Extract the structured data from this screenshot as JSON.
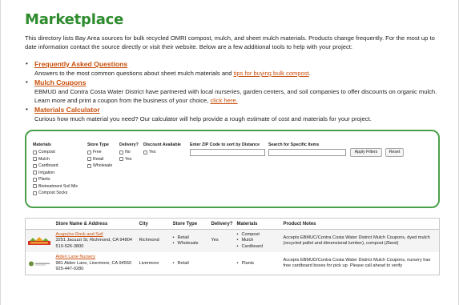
{
  "page": {
    "title": "Marketplace",
    "intro": "This directory lists Bay Area sources for bulk recycled OMRI compost, mulch, and sheet mulch materials. Products change frequently. For the most up to date information contact the source directly or visit their website. Below are a few additional tools to help with your project:"
  },
  "tools": [
    {
      "title": "Frequently Asked Questions",
      "desc": "Answers to the most common questions about sheet mulch materials and ",
      "link": "tips for buying bulk compost",
      "after": "."
    },
    {
      "title": "Mulch Coupons",
      "desc": "EBMUD and Contra Costa Water District have partnered with local nurseries, garden centers, and soil companies to offer discounts on organic mulch. Learn more and print a coupon from the business of your choice, ",
      "link": "click here.",
      "after": ""
    },
    {
      "title": "Materials Calculator",
      "desc": "Curious how much material you need?  Our calculator will help provide a rough estimate of cost and materials for your project.",
      "link": "",
      "after": ""
    }
  ],
  "filters": {
    "materials_label": "Materials",
    "materials": [
      "Compost",
      "Mulch",
      "Cardboard",
      "Irrigation",
      "Plants",
      "Biotreatment Soil Mix",
      "Compost Socks"
    ],
    "store_type_label": "Store Type",
    "store_types": [
      "Free",
      "Retail",
      "Wholesale"
    ],
    "delivery_label": "Delivery?",
    "delivery": [
      "No",
      "Yes"
    ],
    "discount_label": "Discount Available",
    "discount": [
      "Yes"
    ],
    "zip_label": "Enter ZIP Code to sort by Distance",
    "zip_value": "",
    "search_label": "Search for Specific Items",
    "search_value": "",
    "apply_label": "Apply Filters",
    "reset_label": "Reset"
  },
  "table": {
    "headers": [
      "",
      "Store Name & Address",
      "City",
      "Store Type",
      "Delivery?",
      "Materials",
      "Product Notes"
    ],
    "rows": [
      {
        "logo": "acapulco-logo",
        "name": "Acapulco Rock and Soil",
        "address": "3251 Jacuzzi St, Richmond, CA 94804",
        "phone": "510-526-3800",
        "city": "Richmond",
        "store_type": [
          "Retail",
          "Wholesale"
        ],
        "delivery": "Yes",
        "materials": [
          "Compost",
          "Mulch",
          "Cardboard"
        ],
        "notes": "Accepts EBMUC/Contra Costa Water District Mulch Coupons, dyed mulch (recycled pallet and dimensional lumber), compost (Zbest)"
      },
      {
        "logo": "alden-lane-logo",
        "name": "Alden Lane Nursery",
        "address": "981 Alden Lane, Livermore, CA 94550",
        "phone": "925-447-0280",
        "city": "Livermore",
        "store_type": [
          "Retail"
        ],
        "delivery": "",
        "materials": [
          "Plants"
        ],
        "notes": "Accepts EBMUD/Contra Costa Water District Mulch Coupons, nursery has free cardboard boxes for pick up. Please call ahead to verify"
      }
    ]
  },
  "colors": {
    "brand_green": "#2e8b2e",
    "link_orange": "#c94f0b",
    "border_green": "#4aa04a"
  }
}
